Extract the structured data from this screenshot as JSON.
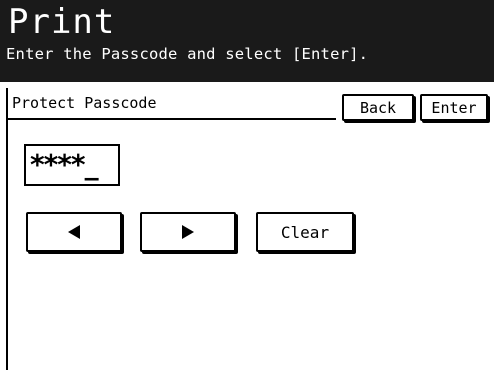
{
  "header": {
    "title": "Print",
    "instruction": "Enter the Passcode and select [Enter]."
  },
  "field": {
    "label": "Protect Passcode",
    "value_masked": "****",
    "cursor": "_"
  },
  "buttons": {
    "back_label": "Back",
    "enter_label": "Enter",
    "clear_label": "Clear"
  },
  "icons": {
    "cursor_left": "left-arrow-icon",
    "cursor_right": "right-arrow-icon"
  },
  "colors": {
    "header_background": "#1a1a1a",
    "header_text": "#ffffff",
    "screen_background": "#ffffff",
    "foreground": "#000000"
  }
}
